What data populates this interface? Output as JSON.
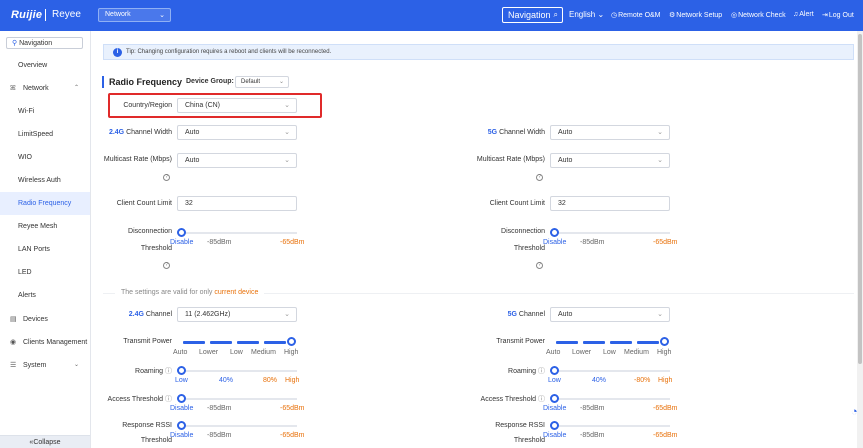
{
  "header": {
    "brand": "Ruijie",
    "product": "Reyee",
    "network_select": "Network",
    "nav_search": "Navigation",
    "language": "English",
    "items": [
      "Remote O&M",
      "Network Setup",
      "Network Check",
      "Alert",
      "Log Out"
    ]
  },
  "sidebar": {
    "search_placeholder": "Navigation",
    "items": [
      {
        "label": "Overview"
      },
      {
        "label": "Network"
      },
      {
        "label": "Wi-Fi"
      },
      {
        "label": "LimitSpeed"
      },
      {
        "label": "WIO"
      },
      {
        "label": "Wireless Auth"
      },
      {
        "label": "Radio Frequency"
      },
      {
        "label": "Reyee Mesh"
      },
      {
        "label": "LAN Ports"
      },
      {
        "label": "LED"
      },
      {
        "label": "Alerts"
      },
      {
        "label": "Devices"
      },
      {
        "label": "Clients Management"
      },
      {
        "label": "System"
      }
    ],
    "collapse": "«Collapse"
  },
  "main": {
    "tip": "Tip: Changing configuration requires a reboot and clients will be reconnected.",
    "title": "Radio Frequency",
    "device_group_label": "Device Group:",
    "device_group_value": "Default",
    "country_label": "Country/Region",
    "country_value": "China (CN)",
    "band24": "2.4G",
    "band5": "5G",
    "channel_width_label": "Channel Width",
    "channel_width_24": "Auto",
    "channel_width_5": "Auto",
    "multicast_label": "Multicast Rate (Mbps)",
    "multicast_24": "Auto",
    "multicast_5": "Auto",
    "client_limit_label": "Client Count Limit",
    "client_limit_24": "32",
    "client_limit_5": "32",
    "disconnection_label_1": "Disconnection",
    "disconnection_label_2": "Threshold",
    "disable": "Disable",
    "dbm85": "-85dBm",
    "dbm65": "-65dBm",
    "valid_prefix": "The settings are valid for only",
    "valid_suffix": "current device",
    "channel_label": "Channel",
    "channel_24": "11  (2.462GHz)",
    "channel_5": "Auto",
    "transmit_label": "Transmit Power",
    "tp_auto": "Auto",
    "tp_lower": "Lower",
    "tp_low": "Low",
    "tp_medium": "Medium",
    "tp_high": "High",
    "roaming_label": "Roaming",
    "r_low": "Low",
    "r_40": "40%",
    "r_80_left": "80%",
    "r_80_right": "-80%",
    "r_high": "High",
    "access_label": "Access Threshold",
    "rssi_label": "Response RSSI",
    "rssi_label2": "Threshold"
  },
  "colors": {
    "accent": "#2c61e6",
    "warn": "#e8710a",
    "highlight_box": "#e02a2a"
  }
}
